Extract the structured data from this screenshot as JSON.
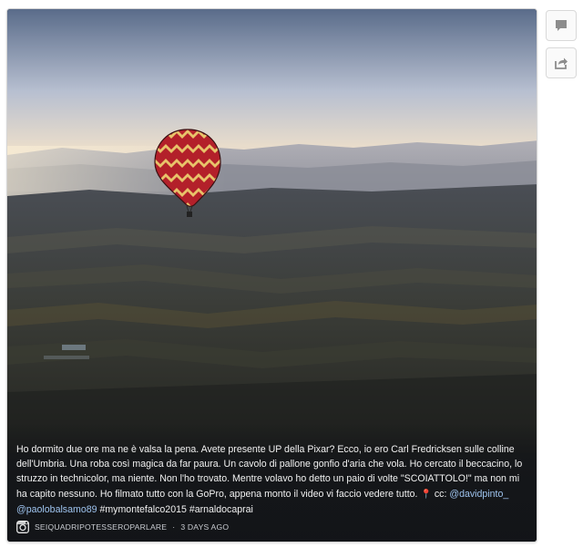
{
  "post": {
    "image_description": "hot-air-balloon-over-umbria",
    "caption": {
      "text_main": "Ho dormito due ore ma ne è valsa la pena. Avete presente UP della Pixar? Ecco, io ero Carl Fredricksen sulle colline dell'Umbria. Una roba così magica da far paura. Un cavolo di pallone gonfio d'aria che vola. Ho cercato il beccacino, lo struzzo in technicolor, ma niente. Non l'ho trovato. Mentre volavo ho detto un paio di volte \"SCOIATTOLO!\" ma non mi ha capito nessuno. Ho filmato tutto con la GoPro, appena monto il video vi faccio vedere tutto.",
      "pin_glyph": "📍",
      "cc_label": "cc:",
      "mention_1": "@davidpinto_",
      "mention_2": "@paolobalsamo89",
      "hashtags": "#mymontefalco2015 #arnaldocaprai"
    },
    "username": "SEIQUADRIPOTESSEROPARLARE",
    "separator": "·",
    "timestamp": "3 DAYS AGO"
  },
  "sidebar": {
    "comment_icon": "comment-icon",
    "share_icon": "share-icon"
  },
  "colors": {
    "mention": "#9ec3ee",
    "card_bg": "#121418",
    "balloon_red": "#b3202a",
    "balloon_yellow": "#e8c36a"
  }
}
